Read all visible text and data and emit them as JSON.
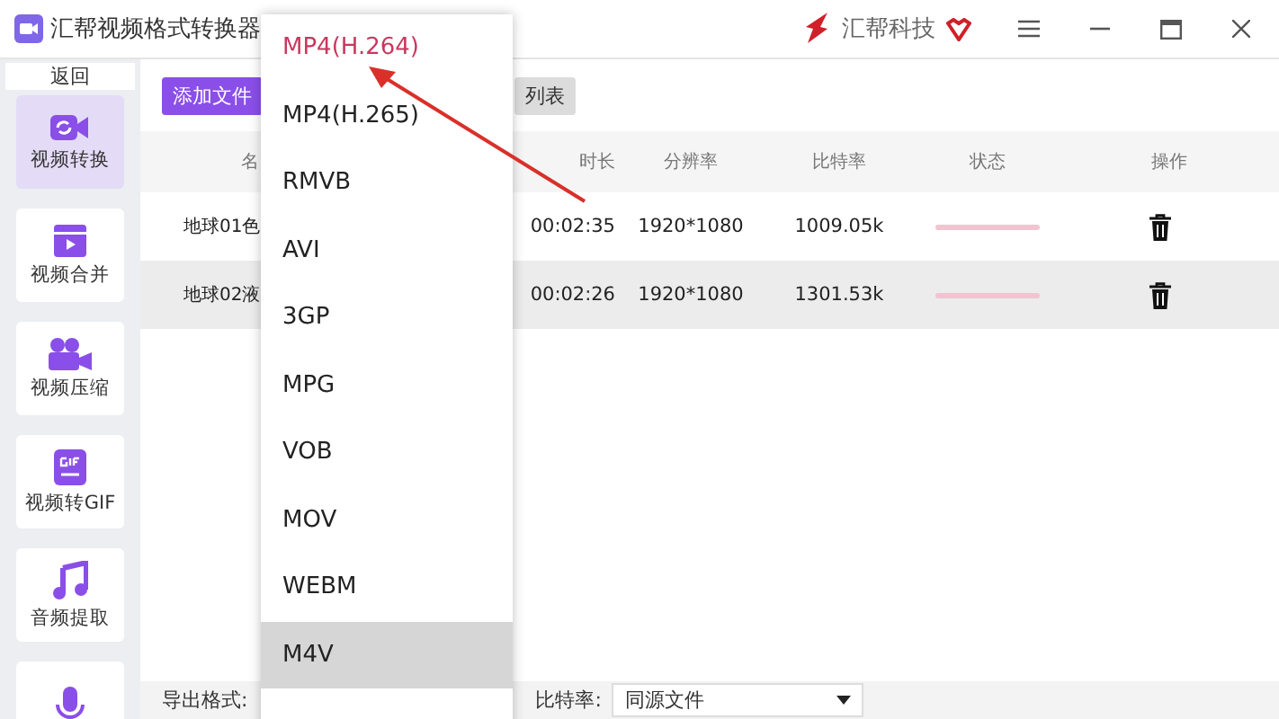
{
  "window": {
    "title": "汇帮视频格式转换器",
    "brand": "汇帮科技"
  },
  "sidebar": {
    "back": "返回",
    "items": [
      {
        "kind": "convert",
        "label": "视频转换",
        "selected": true
      },
      {
        "kind": "merge",
        "label": "视频合并",
        "selected": false
      },
      {
        "kind": "compress",
        "label": "视频压缩",
        "selected": false
      },
      {
        "kind": "gif",
        "label": "视频转GIF",
        "selected": false
      },
      {
        "kind": "audio",
        "label": "音频提取",
        "selected": false
      },
      {
        "kind": "mic",
        "selected": false
      }
    ]
  },
  "toolbar": {
    "buttons": [
      {
        "kind": "primary",
        "label": "添加文件"
      },
      {
        "kind": "secondary",
        "label": "列表"
      }
    ]
  },
  "table": {
    "columns": [
      "名",
      "时长",
      "分辨率",
      "比特率",
      "状态",
      "操作"
    ],
    "rows": [
      {
        "name": "地球01色",
        "duration": "00:02:35",
        "resolution": "1920*1080",
        "bitrate": "1009.05k",
        "selected": false
      },
      {
        "name": "地球02液",
        "duration": "00:02:26",
        "resolution": "1920*1080",
        "bitrate": "1301.53k",
        "selected": true
      }
    ]
  },
  "format_dropdown": {
    "options": [
      {
        "label": "MP4(H.264)",
        "selected": true,
        "highlighted": false
      },
      {
        "label": "MP4(H.265)",
        "selected": false,
        "highlighted": false
      },
      {
        "label": "RMVB",
        "selected": false,
        "highlighted": false
      },
      {
        "label": "AVI",
        "selected": false,
        "highlighted": false
      },
      {
        "label": "3GP",
        "selected": false,
        "highlighted": false
      },
      {
        "label": "MPG",
        "selected": false,
        "highlighted": false
      },
      {
        "label": "VOB",
        "selected": false,
        "highlighted": false
      },
      {
        "label": "MOV",
        "selected": false,
        "highlighted": false
      },
      {
        "label": "WEBM",
        "selected": false,
        "highlighted": false
      },
      {
        "label": "M4V",
        "selected": false,
        "highlighted": true
      }
    ]
  },
  "bottom_bar": {
    "format_label": "导出格式:",
    "bitrate_label": "比特率:",
    "bitrate_value": "同源文件"
  }
}
